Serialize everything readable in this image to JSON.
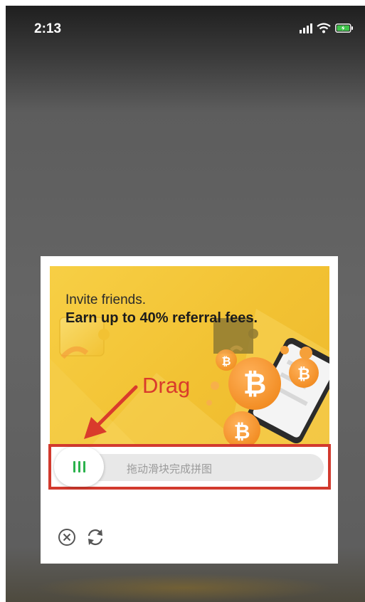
{
  "status_bar": {
    "time": "2:13"
  },
  "captcha": {
    "banner": {
      "line1": "Invite friends.",
      "line2": "Earn up to 40% referral fees."
    },
    "slider": {
      "hint": "拖动滑块完成拼图"
    },
    "footer": {
      "close_icon": "close-icon",
      "refresh_icon": "refresh-icon"
    }
  },
  "annotation": {
    "drag_label": "Drag"
  },
  "colors": {
    "banner_yellow": "#f3c53a",
    "accent_orange": "#f5a03a",
    "annotation_red": "#d93b2c",
    "handle_green": "#2bb24c"
  }
}
